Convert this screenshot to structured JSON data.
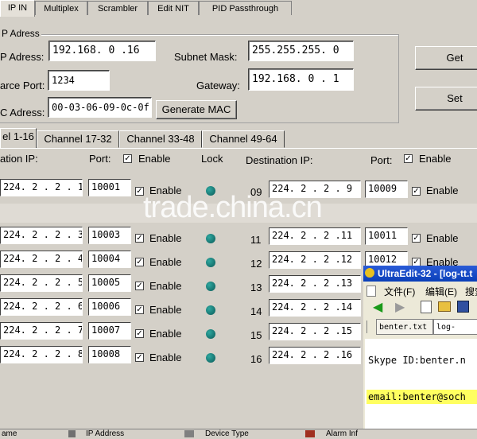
{
  "tabs": [
    "IP IN",
    "Multiplex",
    "Scrambler",
    "Edit NIT",
    "PID Passthrough"
  ],
  "ip_group": {
    "title": "P Adress",
    "ip_label": "P Adress:",
    "ip_value": "192.168. 0 .16",
    "subnet_label": "Subnet Mask:",
    "subnet_value": "255.255.255. 0",
    "source_port_label": "arce Port:",
    "source_port_value": "1234",
    "gateway_label": "Gateway:",
    "gateway_value": "192.168. 0 . 1",
    "mac_label": "C Adress:",
    "mac_value": "00-03-06-09-0c-0f",
    "generate_mac": "Generate MAC"
  },
  "buttons": {
    "get": "Get",
    "set": "Set"
  },
  "channel_tabs": [
    "el 1-16",
    "Channel 17-32",
    "Channel 33-48",
    "Channel 49-64"
  ],
  "headers": {
    "dest_ip_left": "ation IP:",
    "port_left": "Port:",
    "enable_left": "Enable",
    "lock": "Lock",
    "dest_ip_right": "Destination IP:",
    "port_right": "Port:",
    "enable_right": "Enable"
  },
  "left_rows": [
    {
      "ip": "224. 2 . 2 . 1",
      "port": "10001",
      "enable": "Enable"
    },
    {
      "ip": "224. 2 . 2 . 3",
      "port": "10003",
      "enable": "Enable"
    },
    {
      "ip": "224. 2 . 2 . 4",
      "port": "10004",
      "enable": "Enable"
    },
    {
      "ip": "224. 2 . 2 . 5",
      "port": "10005",
      "enable": "Enable"
    },
    {
      "ip": "224. 2 . 2 . 6",
      "port": "10006",
      "enable": "Enable"
    },
    {
      "ip": "224. 2 . 2 . 7",
      "port": "10007",
      "enable": "Enable"
    },
    {
      "ip": "224. 2 . 2 . 8",
      "port": "10008",
      "enable": "Enable"
    }
  ],
  "right_rows": [
    {
      "num": "09",
      "ip": "224. 2 . 2 . 9",
      "port": "10009",
      "enable": "Enable"
    },
    {
      "num": "11",
      "ip": "224. 2 . 2 .11",
      "port": "10011",
      "enable": "Enable"
    },
    {
      "num": "12",
      "ip": "224. 2 . 2 .12",
      "port": "10012",
      "enable": "Enable"
    },
    {
      "num": "13",
      "ip": "224. 2 . 2 .13",
      "port": "",
      "enable": ""
    },
    {
      "num": "14",
      "ip": "224. 2 . 2 .14",
      "port": "",
      "enable": ""
    },
    {
      "num": "15",
      "ip": "224. 2 . 2 .15",
      "port": "",
      "enable": ""
    },
    {
      "num": "16",
      "ip": "224. 2 . 2 .16",
      "port": "",
      "enable": ""
    }
  ],
  "watermark": "trade.china.cn",
  "ultraedit": {
    "title": "UltraEdit-32 - [log-tt.t",
    "menu": [
      "文件(F)",
      "编辑(E)",
      "搜索"
    ],
    "file_tabs": [
      "benter.txt",
      "log-tt.tx"
    ],
    "lines": [
      "Skype ID:benter.n",
      "email:benter@soch"
    ],
    "highlight_color": "#ffff60"
  },
  "status_bar": [
    "ame",
    "IP Address",
    "Device Type",
    "Alarm Inf"
  ]
}
